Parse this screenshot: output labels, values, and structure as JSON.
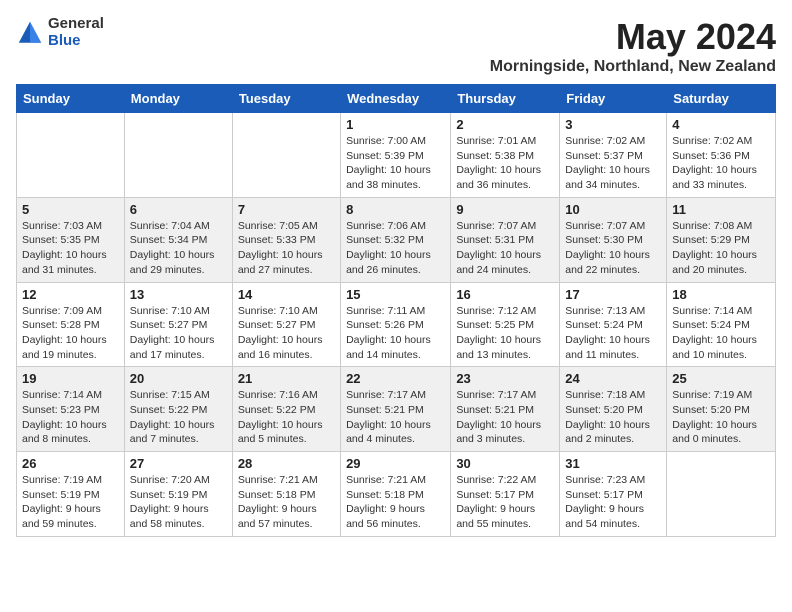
{
  "logo": {
    "general": "General",
    "blue": "Blue"
  },
  "title": {
    "month": "May 2024",
    "location": "Morningside, Northland, New Zealand"
  },
  "headers": [
    "Sunday",
    "Monday",
    "Tuesday",
    "Wednesday",
    "Thursday",
    "Friday",
    "Saturday"
  ],
  "rows": [
    [
      {
        "day": "",
        "info": ""
      },
      {
        "day": "",
        "info": ""
      },
      {
        "day": "",
        "info": ""
      },
      {
        "day": "1",
        "info": "Sunrise: 7:00 AM\nSunset: 5:39 PM\nDaylight: 10 hours\nand 38 minutes."
      },
      {
        "day": "2",
        "info": "Sunrise: 7:01 AM\nSunset: 5:38 PM\nDaylight: 10 hours\nand 36 minutes."
      },
      {
        "day": "3",
        "info": "Sunrise: 7:02 AM\nSunset: 5:37 PM\nDaylight: 10 hours\nand 34 minutes."
      },
      {
        "day": "4",
        "info": "Sunrise: 7:02 AM\nSunset: 5:36 PM\nDaylight: 10 hours\nand 33 minutes."
      }
    ],
    [
      {
        "day": "5",
        "info": "Sunrise: 7:03 AM\nSunset: 5:35 PM\nDaylight: 10 hours\nand 31 minutes."
      },
      {
        "day": "6",
        "info": "Sunrise: 7:04 AM\nSunset: 5:34 PM\nDaylight: 10 hours\nand 29 minutes."
      },
      {
        "day": "7",
        "info": "Sunrise: 7:05 AM\nSunset: 5:33 PM\nDaylight: 10 hours\nand 27 minutes."
      },
      {
        "day": "8",
        "info": "Sunrise: 7:06 AM\nSunset: 5:32 PM\nDaylight: 10 hours\nand 26 minutes."
      },
      {
        "day": "9",
        "info": "Sunrise: 7:07 AM\nSunset: 5:31 PM\nDaylight: 10 hours\nand 24 minutes."
      },
      {
        "day": "10",
        "info": "Sunrise: 7:07 AM\nSunset: 5:30 PM\nDaylight: 10 hours\nand 22 minutes."
      },
      {
        "day": "11",
        "info": "Sunrise: 7:08 AM\nSunset: 5:29 PM\nDaylight: 10 hours\nand 20 minutes."
      }
    ],
    [
      {
        "day": "12",
        "info": "Sunrise: 7:09 AM\nSunset: 5:28 PM\nDaylight: 10 hours\nand 19 minutes."
      },
      {
        "day": "13",
        "info": "Sunrise: 7:10 AM\nSunset: 5:27 PM\nDaylight: 10 hours\nand 17 minutes."
      },
      {
        "day": "14",
        "info": "Sunrise: 7:10 AM\nSunset: 5:27 PM\nDaylight: 10 hours\nand 16 minutes."
      },
      {
        "day": "15",
        "info": "Sunrise: 7:11 AM\nSunset: 5:26 PM\nDaylight: 10 hours\nand 14 minutes."
      },
      {
        "day": "16",
        "info": "Sunrise: 7:12 AM\nSunset: 5:25 PM\nDaylight: 10 hours\nand 13 minutes."
      },
      {
        "day": "17",
        "info": "Sunrise: 7:13 AM\nSunset: 5:24 PM\nDaylight: 10 hours\nand 11 minutes."
      },
      {
        "day": "18",
        "info": "Sunrise: 7:14 AM\nSunset: 5:24 PM\nDaylight: 10 hours\nand 10 minutes."
      }
    ],
    [
      {
        "day": "19",
        "info": "Sunrise: 7:14 AM\nSunset: 5:23 PM\nDaylight: 10 hours\nand 8 minutes."
      },
      {
        "day": "20",
        "info": "Sunrise: 7:15 AM\nSunset: 5:22 PM\nDaylight: 10 hours\nand 7 minutes."
      },
      {
        "day": "21",
        "info": "Sunrise: 7:16 AM\nSunset: 5:22 PM\nDaylight: 10 hours\nand 5 minutes."
      },
      {
        "day": "22",
        "info": "Sunrise: 7:17 AM\nSunset: 5:21 PM\nDaylight: 10 hours\nand 4 minutes."
      },
      {
        "day": "23",
        "info": "Sunrise: 7:17 AM\nSunset: 5:21 PM\nDaylight: 10 hours\nand 3 minutes."
      },
      {
        "day": "24",
        "info": "Sunrise: 7:18 AM\nSunset: 5:20 PM\nDaylight: 10 hours\nand 2 minutes."
      },
      {
        "day": "25",
        "info": "Sunrise: 7:19 AM\nSunset: 5:20 PM\nDaylight: 10 hours\nand 0 minutes."
      }
    ],
    [
      {
        "day": "26",
        "info": "Sunrise: 7:19 AM\nSunset: 5:19 PM\nDaylight: 9 hours\nand 59 minutes."
      },
      {
        "day": "27",
        "info": "Sunrise: 7:20 AM\nSunset: 5:19 PM\nDaylight: 9 hours\nand 58 minutes."
      },
      {
        "day": "28",
        "info": "Sunrise: 7:21 AM\nSunset: 5:18 PM\nDaylight: 9 hours\nand 57 minutes."
      },
      {
        "day": "29",
        "info": "Sunrise: 7:21 AM\nSunset: 5:18 PM\nDaylight: 9 hours\nand 56 minutes."
      },
      {
        "day": "30",
        "info": "Sunrise: 7:22 AM\nSunset: 5:17 PM\nDaylight: 9 hours\nand 55 minutes."
      },
      {
        "day": "31",
        "info": "Sunrise: 7:23 AM\nSunset: 5:17 PM\nDaylight: 9 hours\nand 54 minutes."
      },
      {
        "day": "",
        "info": ""
      }
    ]
  ]
}
